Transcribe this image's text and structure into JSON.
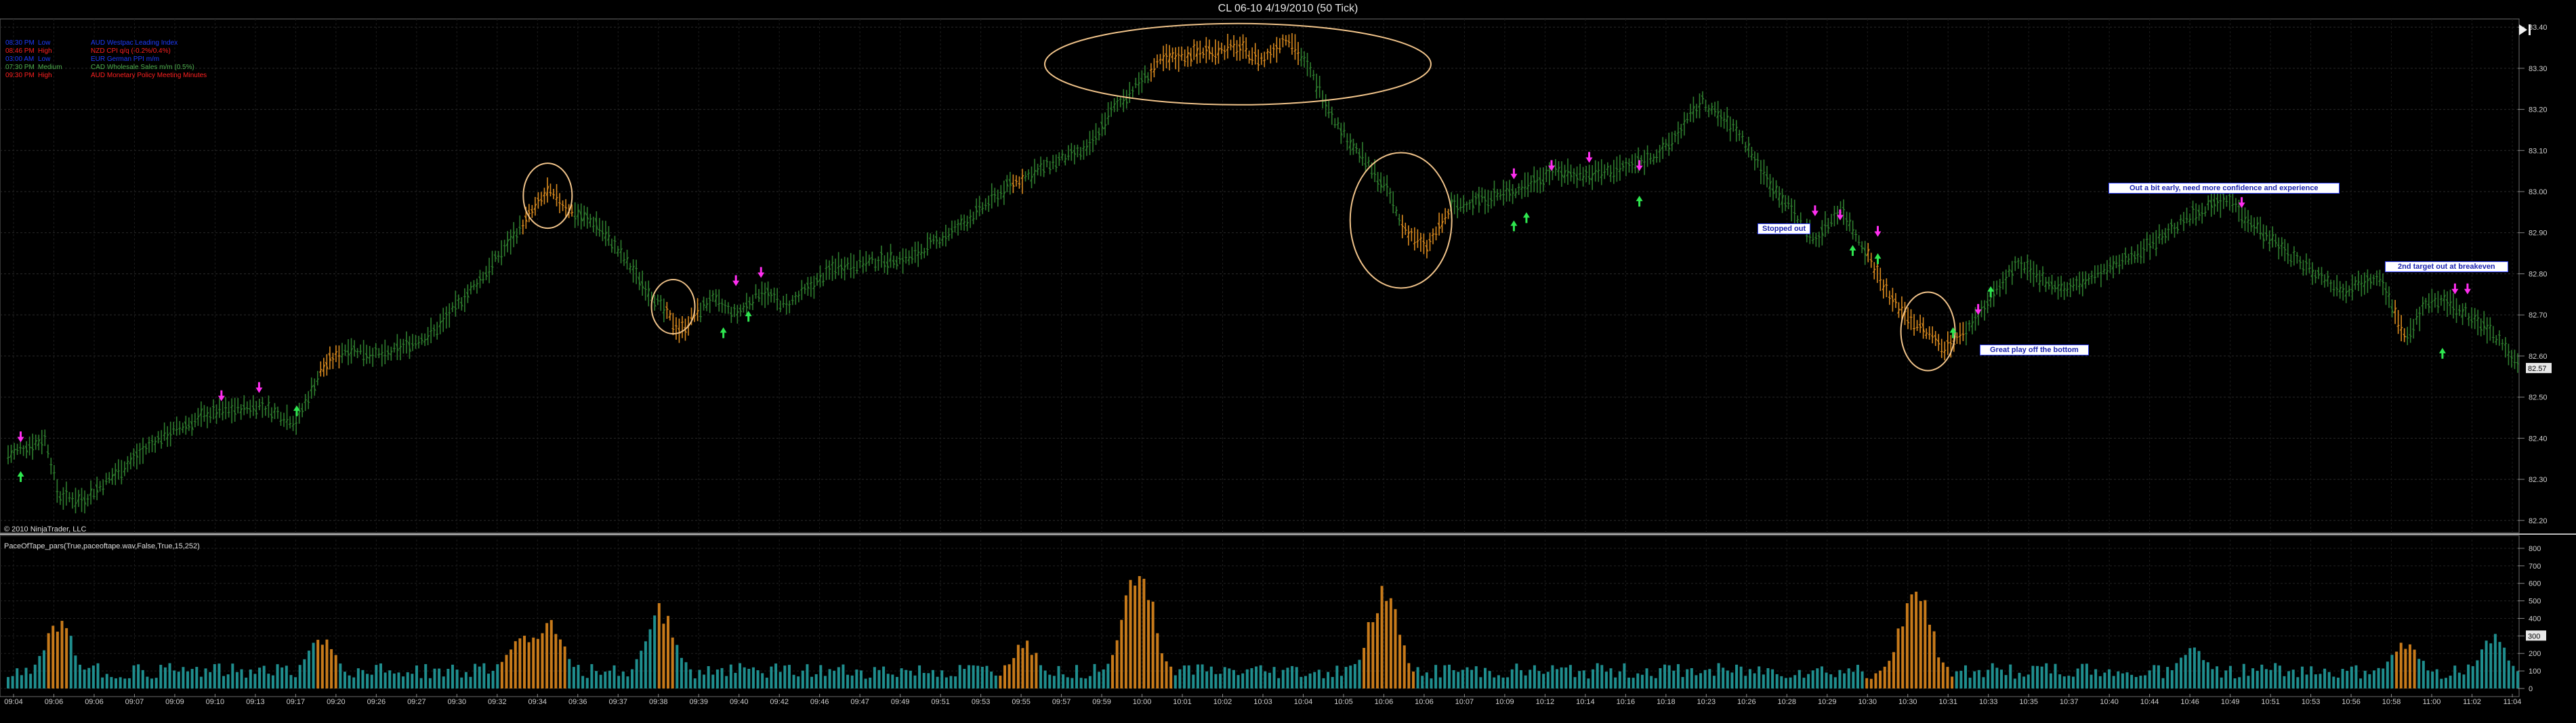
{
  "window": {
    "title": "CL 06-10  4/19/2010 (50 Tick)"
  },
  "copyright": "© 2010 NinjaTrader, LLC",
  "indicator": {
    "label": "PaceOfTape_pars(True,paceoftape.wav,False,True,15,252)"
  },
  "news": [
    {
      "time": "08:30 PM",
      "impact": "Low",
      "text": "AUD Westpac Leading Index",
      "color": "#1e3cff"
    },
    {
      "time": "08:46 PM",
      "impact": "High",
      "text": "NZD CPI q/q (-0.2%/0.4%)",
      "color": "#ff2020"
    },
    {
      "time": "03:00 AM",
      "impact": "Low",
      "text": "EUR German PPI m/m",
      "color": "#1e3cff"
    },
    {
      "time": "07:30 PM",
      "impact": "Medium",
      "text": "CAD Wholesale Sales m/m (0.5%)",
      "color": "#4fb04f"
    },
    {
      "time": "09:30 PM",
      "impact": "High",
      "text": "AUD Monetary Policy Meeting Minutes",
      "color": "#ff2020"
    }
  ],
  "annotations": [
    {
      "text": "Stopped out"
    },
    {
      "text": "Out a bit early, need more confidence and experience"
    },
    {
      "text": "2nd target out at breakeven"
    },
    {
      "text": "Great play off the bottom"
    }
  ],
  "colors": {
    "background": "#000000",
    "bar_up": "#2e7d2e",
    "bar_signal": "#d98a1f",
    "volume_normal": "#1f8e8e",
    "volume_high": "#c77a1a",
    "buy_arrow": "#2ee64f",
    "sell_arrow": "#ff2ef0",
    "circle": "#f0c38a"
  },
  "icons": [
    "play-icon",
    "buy-arrow-icon",
    "sell-arrow-icon"
  ],
  "chart_data": [
    {
      "type": "candlestick",
      "title": "CL 06-10  4/19/2010 (50 Tick)",
      "ylim": [
        82.17,
        83.42
      ],
      "y_ticks": [
        "83.40",
        "83.30",
        "83.20",
        "83.10",
        "83.00",
        "82.90",
        "82.80",
        "82.70",
        "82.60",
        "82.50",
        "82.40",
        "82.30",
        "82.20"
      ],
      "last_price": "82.57",
      "grid": true,
      "x_ticks": [
        "09:04",
        "09:06",
        "09:06",
        "09:07",
        "09:09",
        "09:10",
        "09:13",
        "09:17",
        "09:20",
        "09:26",
        "09:27",
        "09:30",
        "09:32",
        "09:34",
        "09:36",
        "09:37",
        "09:38",
        "09:39",
        "09:40",
        "09:42",
        "09:46",
        "09:47",
        "09:49",
        "09:51",
        "09:53",
        "09:55",
        "09:57",
        "09:59",
        "10:00",
        "10:01",
        "10:02",
        "10:03",
        "10:04",
        "10:05",
        "10:06",
        "10:06",
        "10:07",
        "10:09",
        "10:12",
        "10:14",
        "10:16",
        "10:18",
        "10:23",
        "10:26",
        "10:28",
        "10:29",
        "10:30",
        "10:30",
        "10:31",
        "10:33",
        "10:35",
        "10:37",
        "10:40",
        "10:44",
        "10:46",
        "10:49",
        "10:51",
        "10:53",
        "10:56",
        "10:58",
        "11:00",
        "11:02",
        "11:04"
      ],
      "price_path": [
        [
          0,
          82.36
        ],
        [
          0.015,
          82.4
        ],
        [
          0.02,
          82.26
        ],
        [
          0.03,
          82.25
        ],
        [
          0.06,
          82.4
        ],
        [
          0.08,
          82.46
        ],
        [
          0.1,
          82.48
        ],
        [
          0.115,
          82.44
        ],
        [
          0.125,
          82.57
        ],
        [
          0.135,
          82.62
        ],
        [
          0.15,
          82.6
        ],
        [
          0.17,
          82.66
        ],
        [
          0.19,
          82.8
        ],
        [
          0.205,
          82.92
        ],
        [
          0.215,
          83.0
        ],
        [
          0.225,
          82.95
        ],
        [
          0.235,
          82.92
        ],
        [
          0.25,
          82.8
        ],
        [
          0.26,
          82.72
        ],
        [
          0.268,
          82.66
        ],
        [
          0.28,
          82.74
        ],
        [
          0.29,
          82.7
        ],
        [
          0.3,
          82.76
        ],
        [
          0.31,
          82.72
        ],
        [
          0.33,
          82.82
        ],
        [
          0.36,
          82.84
        ],
        [
          0.38,
          82.92
        ],
        [
          0.4,
          83.02
        ],
        [
          0.42,
          83.08
        ],
        [
          0.43,
          83.1
        ],
        [
          0.44,
          83.2
        ],
        [
          0.46,
          83.32
        ],
        [
          0.475,
          83.34
        ],
        [
          0.49,
          83.35
        ],
        [
          0.5,
          83.32
        ],
        [
          0.51,
          83.38
        ],
        [
          0.52,
          83.28
        ],
        [
          0.53,
          83.16
        ],
        [
          0.55,
          83.0
        ],
        [
          0.555,
          82.92
        ],
        [
          0.565,
          82.86
        ],
        [
          0.575,
          82.96
        ],
        [
          0.585,
          82.98
        ],
        [
          0.6,
          83.0
        ],
        [
          0.615,
          83.05
        ],
        [
          0.63,
          83.04
        ],
        [
          0.645,
          83.06
        ],
        [
          0.66,
          83.1
        ],
        [
          0.675,
          83.22
        ],
        [
          0.69,
          83.14
        ],
        [
          0.7,
          83.04
        ],
        [
          0.71,
          82.96
        ],
        [
          0.72,
          82.88
        ],
        [
          0.73,
          82.96
        ],
        [
          0.74,
          82.86
        ],
        [
          0.75,
          82.74
        ],
        [
          0.76,
          82.68
        ],
        [
          0.772,
          82.62
        ],
        [
          0.78,
          82.66
        ],
        [
          0.79,
          82.74
        ],
        [
          0.8,
          82.82
        ],
        [
          0.82,
          82.76
        ],
        [
          0.84,
          82.82
        ],
        [
          0.86,
          82.9
        ],
        [
          0.875,
          82.96
        ],
        [
          0.885,
          82.98
        ],
        [
          0.895,
          82.92
        ],
        [
          0.91,
          82.84
        ],
        [
          0.93,
          82.76
        ],
        [
          0.945,
          82.8
        ],
        [
          0.955,
          82.64
        ],
        [
          0.965,
          82.74
        ],
        [
          0.975,
          82.72
        ],
        [
          0.99,
          82.66
        ],
        [
          1,
          82.58
        ]
      ],
      "signal_segments": [
        [
          0.124,
          0.132
        ],
        [
          0.205,
          0.225
        ],
        [
          0.262,
          0.275
        ],
        [
          0.4,
          0.405
        ],
        [
          0.455,
          0.515
        ],
        [
          0.555,
          0.575
        ],
        [
          0.74,
          0.78
        ],
        [
          0.95,
          0.955
        ]
      ],
      "buy_signals": [
        [
          0.005,
          82.31
        ],
        [
          0.115,
          82.47
        ],
        [
          0.285,
          82.66
        ],
        [
          0.295,
          82.7
        ],
        [
          0.6,
          82.92
        ],
        [
          0.605,
          82.94
        ],
        [
          0.65,
          82.98
        ],
        [
          0.735,
          82.86
        ],
        [
          0.745,
          82.84
        ],
        [
          0.775,
          82.66
        ],
        [
          0.79,
          82.76
        ],
        [
          0.97,
          82.61
        ]
      ],
      "sell_signals": [
        [
          0.005,
          82.4
        ],
        [
          0.085,
          82.5
        ],
        [
          0.1,
          82.52
        ],
        [
          0.29,
          82.78
        ],
        [
          0.3,
          82.8
        ],
        [
          0.6,
          83.04
        ],
        [
          0.615,
          83.06
        ],
        [
          0.63,
          83.08
        ],
        [
          0.65,
          83.06
        ],
        [
          0.72,
          82.95
        ],
        [
          0.73,
          82.94
        ],
        [
          0.745,
          82.9
        ],
        [
          0.785,
          82.71
        ],
        [
          0.89,
          82.97
        ],
        [
          0.975,
          82.76
        ],
        [
          0.98,
          82.76
        ]
      ],
      "highlight_circles": [
        [
          0.215,
          82.99
        ],
        [
          0.265,
          82.72
        ],
        [
          0.49,
          83.31
        ],
        [
          0.555,
          82.93
        ],
        [
          0.765,
          82.66
        ]
      ]
    },
    {
      "type": "bar",
      "name": "PaceOfTape_pars(True,paceoftape.wav,False,True,15,252)",
      "ylim": [
        0,
        850
      ],
      "y_ticks": [
        "800",
        "700",
        "600",
        "500",
        "400",
        "300",
        "200",
        "100",
        "0"
      ],
      "current_value": "300",
      "baseline_level": 100,
      "peaks": [
        [
          0.02,
          420
        ],
        [
          0.125,
          300
        ],
        [
          0.205,
          360
        ],
        [
          0.215,
          420
        ],
        [
          0.26,
          500
        ],
        [
          0.405,
          280
        ],
        [
          0.45,
          780
        ],
        [
          0.548,
          600
        ],
        [
          0.76,
          620
        ],
        [
          0.87,
          260
        ],
        [
          0.955,
          300
        ],
        [
          0.99,
          320
        ]
      ],
      "high_segments": [
        [
          0.015,
          0.025
        ],
        [
          0.123,
          0.131
        ],
        [
          0.195,
          0.222
        ],
        [
          0.258,
          0.266
        ],
        [
          0.395,
          0.41
        ],
        [
          0.44,
          0.465
        ],
        [
          0.54,
          0.56
        ],
        [
          0.74,
          0.775
        ],
        [
          0.95,
          0.96
        ]
      ]
    }
  ]
}
